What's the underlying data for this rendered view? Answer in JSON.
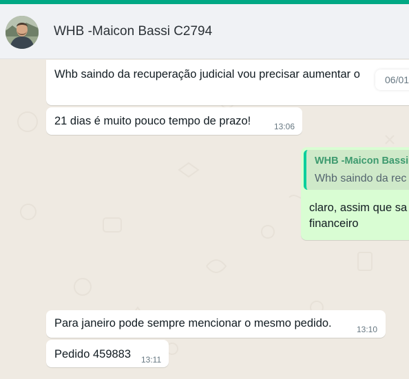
{
  "header": {
    "contact_name": "WHB -Maicon Bassi C2794"
  },
  "messages": [
    {
      "direction": "incoming",
      "text": "Whb saindo da recuperação judicial vou precisar aumentar o",
      "time": "06/01"
    },
    {
      "direction": "incoming",
      "text": "21 dias é muito pouco tempo de prazo!",
      "time": "13:06"
    },
    {
      "direction": "outgoing",
      "quote_author": "WHB -Maicon Bassi",
      "quote_text": "Whb saindo da rec",
      "text_line1": "claro, assim que sa",
      "text_line2": "financeiro"
    },
    {
      "direction": "incoming",
      "text": "Para janeiro pode sempre mencionar o mesmo pedido.",
      "time": "13:10"
    },
    {
      "direction": "incoming",
      "text": "Pedido 459883",
      "time": "13:11"
    }
  ],
  "colors": {
    "accent": "#00a884",
    "chat_background": "#efeae2",
    "incoming_bubble": "#ffffff",
    "outgoing_bubble": "#d9fdd3",
    "quote_author": "#3d9a6e"
  }
}
